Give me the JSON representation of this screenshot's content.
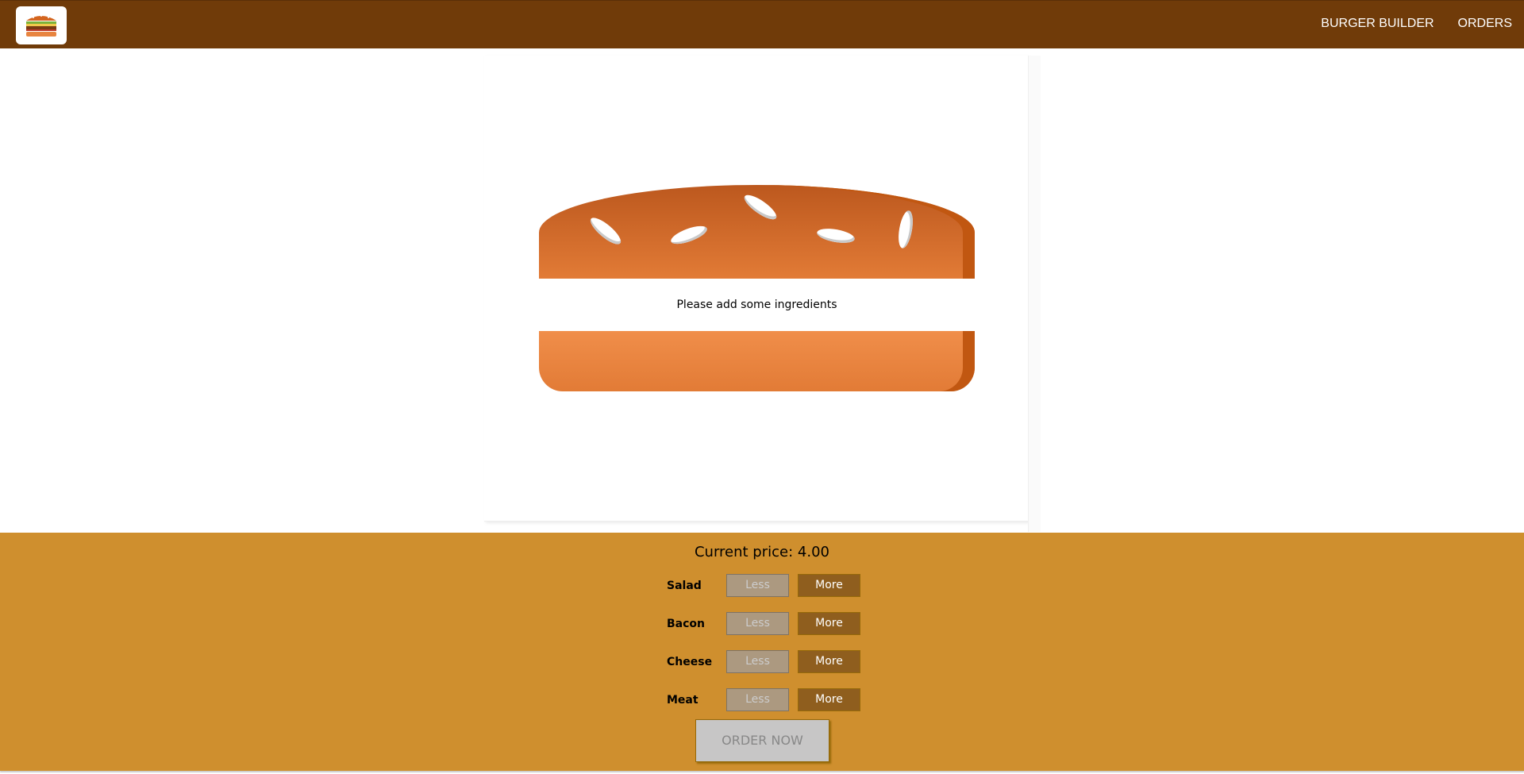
{
  "header": {
    "nav": [
      {
        "label": "BURGER BUILDER"
      },
      {
        "label": "ORDERS"
      }
    ]
  },
  "burger": {
    "message": "Please add some ingredients"
  },
  "controls": {
    "price_label": "Current price:",
    "price_value": "4.00",
    "ingredients": [
      {
        "label": "Salad",
        "less": "Less",
        "more": "More"
      },
      {
        "label": "Bacon",
        "less": "Less",
        "more": "More"
      },
      {
        "label": "Cheese",
        "less": "Less",
        "more": "More"
      },
      {
        "label": "Meat",
        "less": "Less",
        "more": "More"
      }
    ],
    "order_label": "ORDER NOW"
  },
  "colors": {
    "toolbar": "#703B09",
    "controls_bg": "#CF8F2E",
    "more_button": "#8F5E1E",
    "less_button_disabled": "#AC9980",
    "order_button_disabled": "#C7C6C6"
  }
}
